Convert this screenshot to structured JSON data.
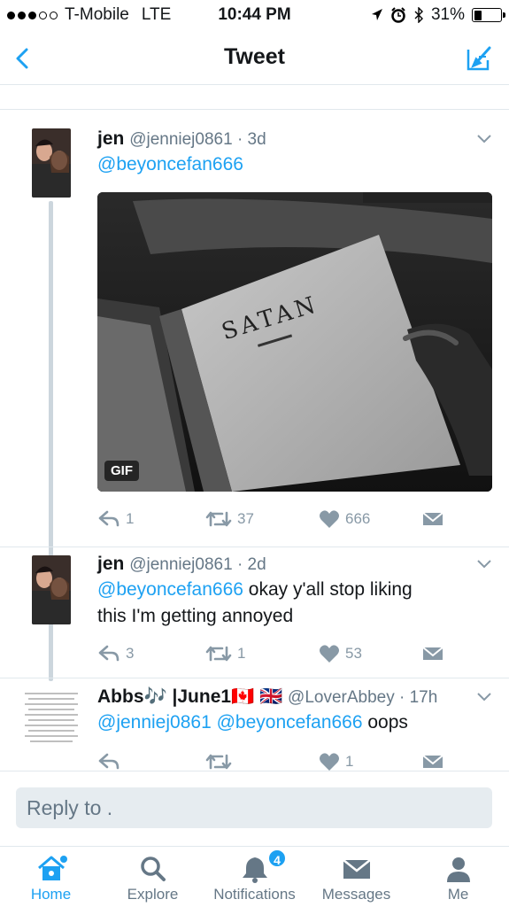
{
  "status_bar": {
    "carrier": "T-Mobile",
    "network": "LTE",
    "time": "10:44 PM",
    "battery": "31%",
    "battery_level": 0.31
  },
  "nav": {
    "title": "Tweet"
  },
  "tweets": [
    {
      "name": "jen",
      "handle": "@jenniej0861 · 3d",
      "mention": "@beyoncefan666",
      "text": "",
      "media_badge": "GIF",
      "media_text": "SATAN",
      "replies": "1",
      "retweets": "37",
      "likes": "666"
    },
    {
      "name": "jen",
      "handle": "@jenniej0861 · 2d",
      "mention": "@beyoncefan666",
      "text": " okay y'all stop liking",
      "text_line2": "this I'm getting annoyed",
      "replies": "3",
      "retweets": "1",
      "likes": "53"
    },
    {
      "name": "Abbs🎶 |June1🇨🇦 🇬🇧",
      "handle": "@LoverAbbey · 17h",
      "mention1": "@jenniej0861",
      "mention2": "@beyoncefan666",
      "text": " oops",
      "replies": "",
      "retweets": "",
      "likes": "1"
    }
  ],
  "reply": {
    "placeholder": "Reply to ."
  },
  "tabs": [
    {
      "label": "Home",
      "icon": "home-icon",
      "active": true
    },
    {
      "label": "Explore",
      "icon": "search-icon"
    },
    {
      "label": "Notifications",
      "icon": "bell-icon",
      "badge": "4"
    },
    {
      "label": "Messages",
      "icon": "envelope-icon"
    },
    {
      "label": "Me",
      "icon": "person-icon"
    }
  ],
  "colors": {
    "accent": "#1da1f2",
    "muted": "#8899a6"
  }
}
